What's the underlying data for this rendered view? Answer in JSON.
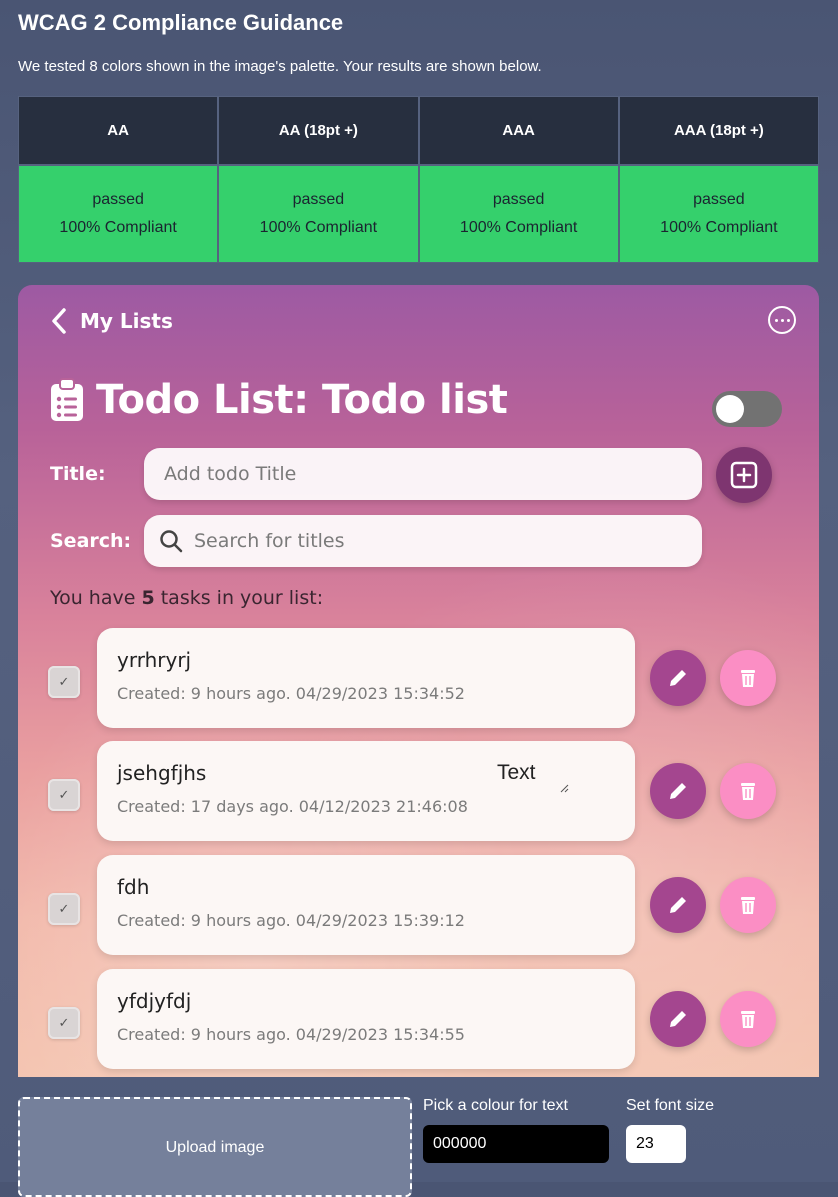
{
  "page": {
    "title": "WCAG 2 Compliance Guidance",
    "subtitle": "We tested 8 colors shown in the image's palette. Your results are shown below."
  },
  "results": {
    "headers": [
      "AA",
      "AA (18pt +)",
      "AAA",
      "AAA (18pt +)"
    ],
    "cells": [
      {
        "status": "passed",
        "compliance": "100% Compliant"
      },
      {
        "status": "passed",
        "compliance": "100% Compliant"
      },
      {
        "status": "passed",
        "compliance": "100% Compliant"
      },
      {
        "status": "passed",
        "compliance": "100% Compliant"
      }
    ],
    "pass_color": "#35d06c",
    "header_color": "#272f3f"
  },
  "preview": {
    "back_label": "My Lists",
    "back_icon": "chevron-left-icon",
    "more_icon": "more-horizontal-icon",
    "heading_icon": "clipboard-list-icon",
    "heading": "Todo List: Todo list",
    "toggle_on": false,
    "title_label": "Title:",
    "title_placeholder": "Add todo Title",
    "search_label": "Search:",
    "search_placeholder": "Search for titles",
    "add_icon": "plus-square-icon",
    "count_prefix": "You have ",
    "count_value": "5",
    "count_suffix": " tasks in your list:",
    "tasks": [
      {
        "name": "yrrhryrj",
        "created": "Created: 9 hours ago. 04/29/2023 15:34:52",
        "extra": ""
      },
      {
        "name": "jsehgfjhs",
        "created": "Created: 17 days ago. 04/12/2023 21:46:08",
        "extra": "Text"
      },
      {
        "name": "fdh",
        "created": "Created: 9 hours ago. 04/29/2023 15:39:12",
        "extra": ""
      },
      {
        "name": "yfdjyfdj",
        "created": "Created: 9 hours ago. 04/29/2023 15:34:55",
        "extra": ""
      }
    ],
    "edit_icon": "pencil-icon",
    "delete_icon": "trash-icon",
    "edit_color": "#a4468f",
    "delete_color": "#fb8ec4"
  },
  "controls": {
    "upload_label": "Upload image",
    "text_color_label": "Pick a colour for text",
    "text_color_value": "000000",
    "font_size_label": "Set font size",
    "font_size_value": "23"
  }
}
